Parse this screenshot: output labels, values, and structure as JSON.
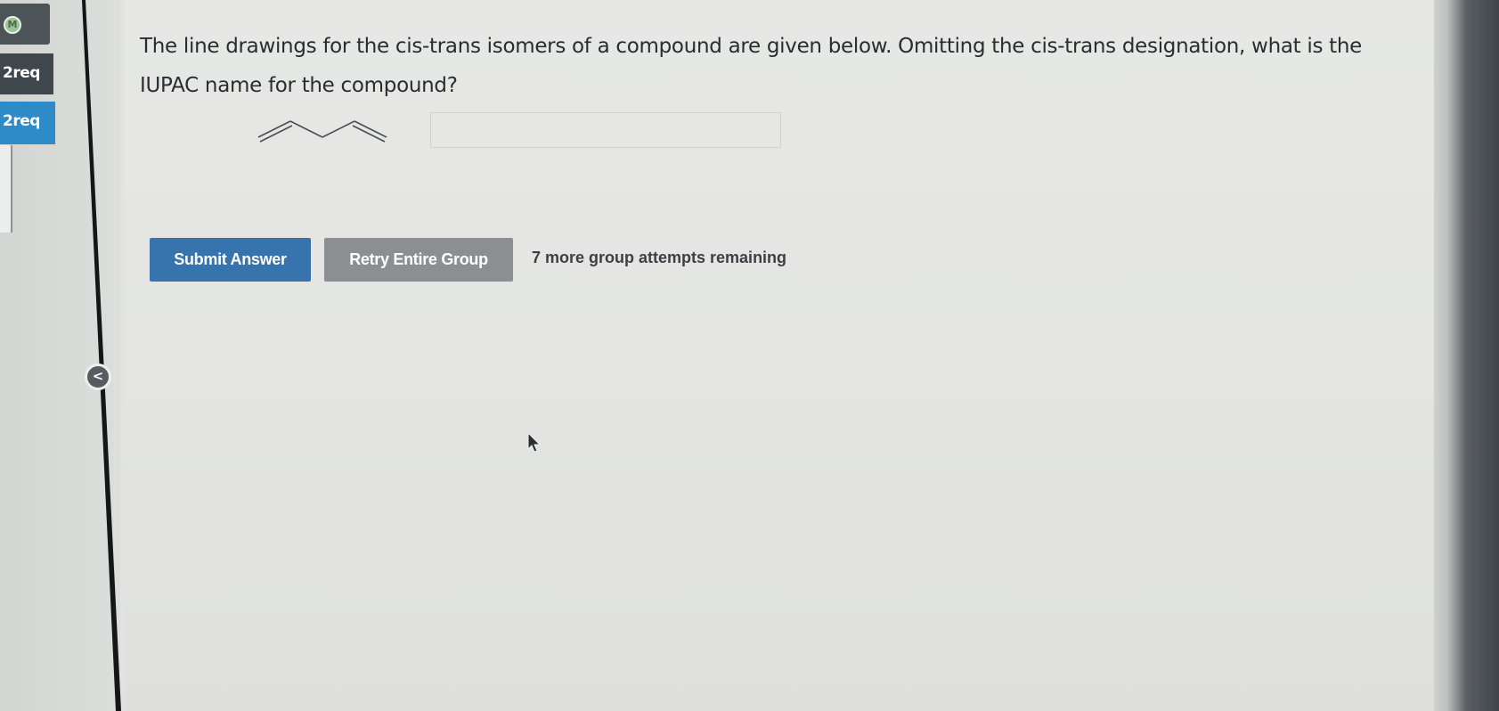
{
  "sidebar": {
    "logo_letter": "M",
    "tabs": [
      {
        "label": "2req"
      },
      {
        "label": "2req"
      }
    ],
    "collapse_glyph": "<"
  },
  "question": {
    "text": "The line drawings for the cis-trans isomers of a compound are given below. Omitting the cis-trans designation, what is the IUPAC name for the compound?"
  },
  "answer": {
    "value": "",
    "placeholder": ""
  },
  "buttons": {
    "submit_label": "Submit Answer",
    "retry_label": "Retry Entire Group"
  },
  "attempts_text": "7 more group attempts remaining",
  "colors": {
    "submit": "#3773ad",
    "retry": "#8c8f91",
    "active_tab": "#2f8ac8"
  }
}
